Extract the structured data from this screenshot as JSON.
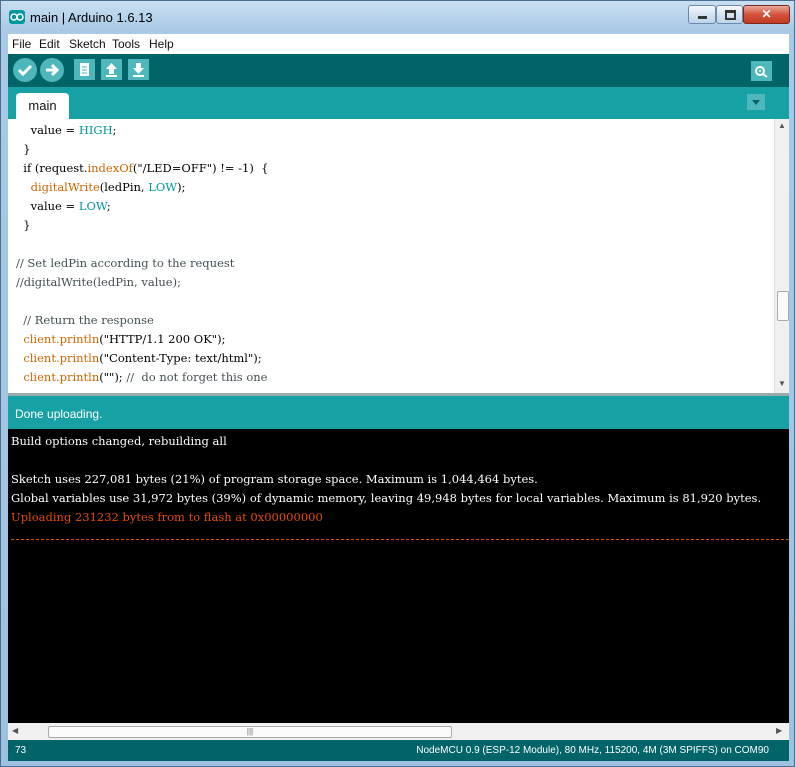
{
  "window": {
    "title": "main | Arduino 1.6.13"
  },
  "menu": [
    "File",
    "Edit",
    "Sketch",
    "Tools",
    "Help"
  ],
  "toolbar": {
    "verify_icon": "check-icon",
    "upload_icon": "arrow-right-icon",
    "new_icon": "new-file-icon",
    "open_icon": "open-arrow-up-icon",
    "save_icon": "save-arrow-down-icon",
    "serial_icon": "serial-monitor-icon"
  },
  "tab": {
    "label": "main"
  },
  "code_lines": [
    "    value = HIGH;",
    "  }",
    "  if (request.indexOf(\"/LED=OFF\") != -1)  {",
    "    digitalWrite(ledPin, LOW);",
    "    value = LOW;",
    "  }",
    "",
    "// Set ledPin according to the request",
    "//digitalWrite(ledPin, value);",
    "",
    "  // Return the response",
    "  client.println(\"HTTP/1.1 200 OK\");",
    "  client.println(\"Content-Type: text/html\");",
    "  client.println(\"\"); //  do not forget this one"
  ],
  "status": {
    "message": "Done uploading."
  },
  "console": {
    "lines": [
      "Build options changed, rebuilding all",
      "",
      "Sketch uses 227,081 bytes (21%) of program storage space. Maximum is 1,044,464 bytes.",
      "Global variables use 31,972 bytes (39%) of dynamic memory, leaving 49,948 bytes for local variables. Maximum is 81,920 bytes."
    ],
    "upload_line": "Uploading 231232 bytes from to flash at 0x00000000"
  },
  "footer": {
    "line_number": "73",
    "board": "NodeMCU 0.9 (ESP-12 Module), 80 MHz, 115200, 4M (3M SPIFFS) on COM90"
  },
  "colors": {
    "toolbar": "#006468",
    "tabbar": "#17a1a5",
    "console_bg": "#000000",
    "error_text": "#e34c00"
  }
}
